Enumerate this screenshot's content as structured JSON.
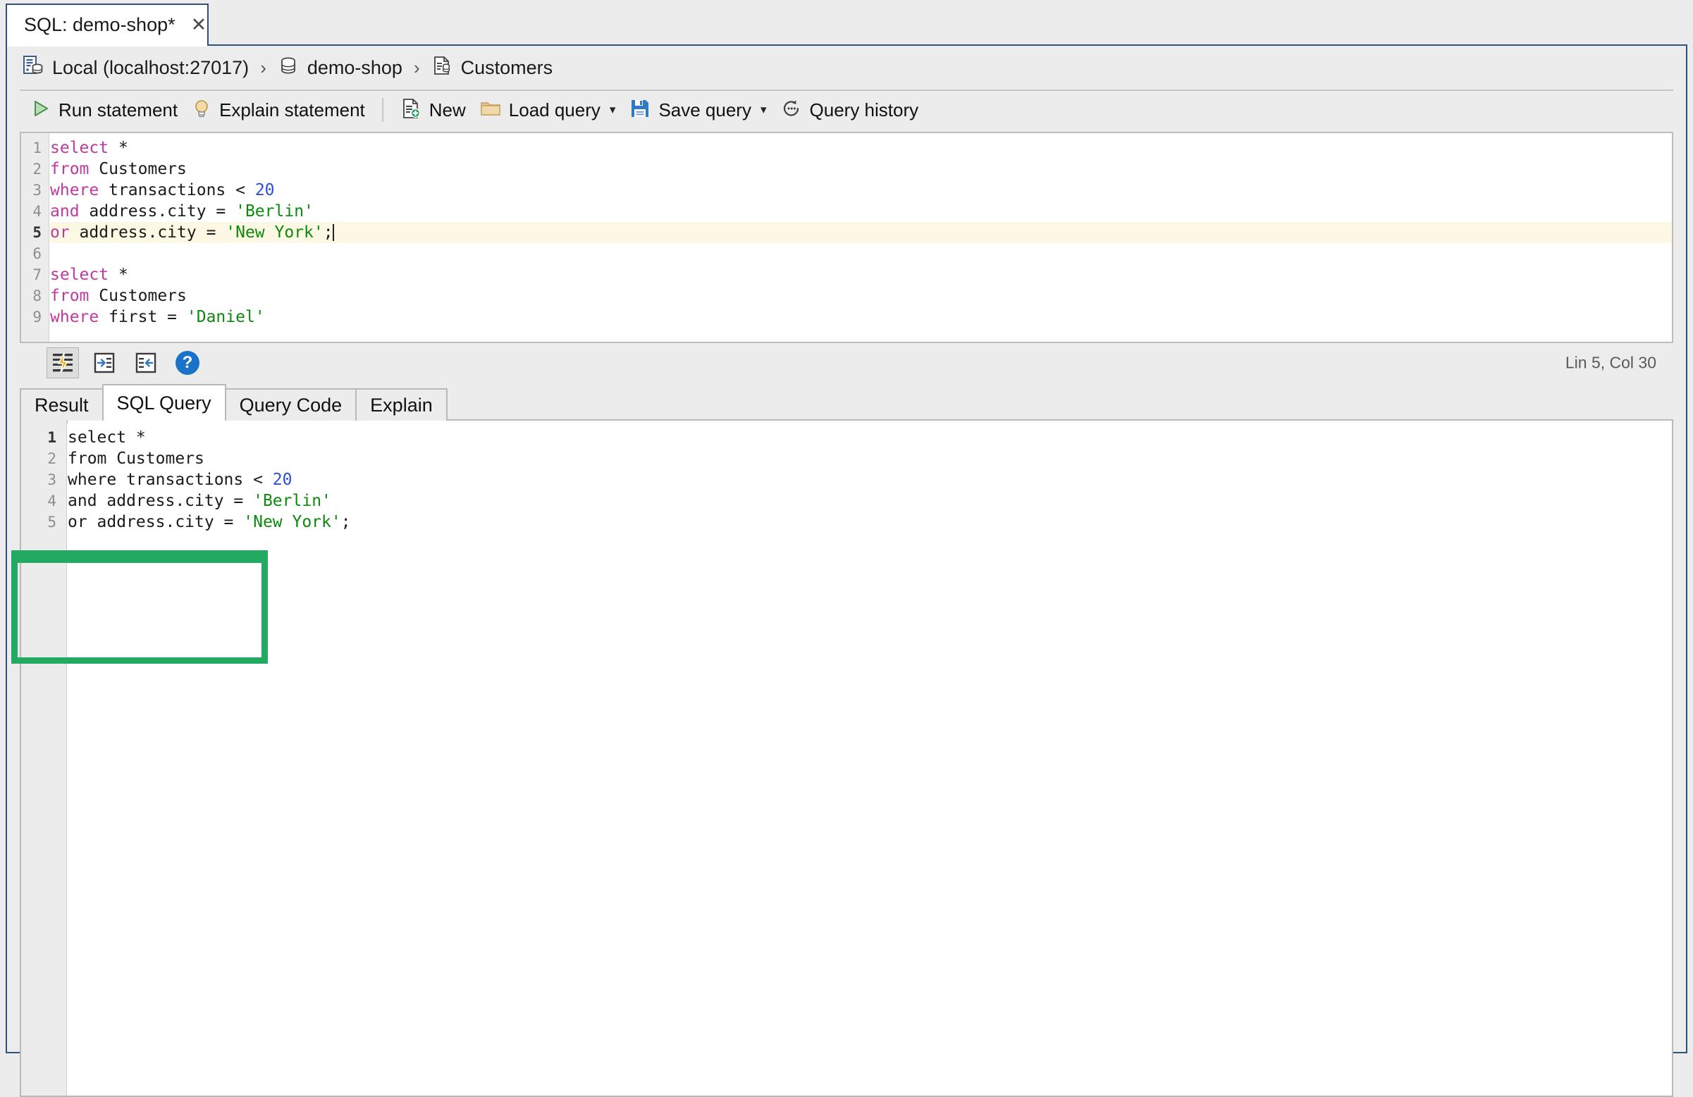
{
  "window": {
    "tab": {
      "title": "SQL: demo-shop*",
      "close_icon": "close-icon"
    }
  },
  "breadcrumb": {
    "items": [
      {
        "icon": "server-database-icon",
        "label": "Local (localhost:27017)"
      },
      {
        "icon": "database-icon",
        "label": "demo-shop"
      },
      {
        "icon": "collection-document-icon",
        "label": "Customers"
      }
    ],
    "separator": "›"
  },
  "toolbar": {
    "run_label": "Run statement",
    "explain_label": "Explain statement",
    "new_label": "New",
    "load_label": "Load query",
    "save_label": "Save query",
    "history_label": "Query history",
    "caret": "▾"
  },
  "editor": {
    "status": {
      "position": "Lin 5, Col 30"
    },
    "buttons": [
      {
        "name": "format-query-button",
        "icon": "format-lightning-icon",
        "active": true
      },
      {
        "name": "indent-right-button",
        "icon": "indent-right-icon",
        "active": false
      },
      {
        "name": "indent-left-button",
        "icon": "indent-left-icon",
        "active": false
      },
      {
        "name": "help-button",
        "icon": "help-circle-icon",
        "label": "?"
      }
    ],
    "lines": [
      {
        "n": "1",
        "tokens": [
          {
            "t": "kw",
            "v": "select"
          },
          {
            "t": "pl",
            "v": " *"
          }
        ]
      },
      {
        "n": "2",
        "tokens": [
          {
            "t": "kw",
            "v": "from"
          },
          {
            "t": "pl",
            "v": " Customers"
          }
        ]
      },
      {
        "n": "3",
        "tokens": [
          {
            "t": "kw",
            "v": "where"
          },
          {
            "t": "pl",
            "v": " transactions < "
          },
          {
            "t": "num",
            "v": "20"
          }
        ]
      },
      {
        "n": "4",
        "tokens": [
          {
            "t": "kw",
            "v": "and"
          },
          {
            "t": "pl",
            "v": " address.city = "
          },
          {
            "t": "str",
            "v": "'Berlin'"
          }
        ]
      },
      {
        "n": "5",
        "current": true,
        "tokens": [
          {
            "t": "kw",
            "v": "or"
          },
          {
            "t": "pl",
            "v": " address.city = "
          },
          {
            "t": "str",
            "v": "'New York'"
          },
          {
            "t": "pl",
            "v": ";"
          }
        ]
      },
      {
        "n": "6",
        "tokens": []
      },
      {
        "n": "7",
        "tokens": [
          {
            "t": "kw",
            "v": "select"
          },
          {
            "t": "pl",
            "v": " *"
          }
        ]
      },
      {
        "n": "8",
        "tokens": [
          {
            "t": "kw",
            "v": "from"
          },
          {
            "t": "pl",
            "v": " Customers"
          }
        ]
      },
      {
        "n": "9",
        "tokens": [
          {
            "t": "kw",
            "v": "where"
          },
          {
            "t": "pl",
            "v": " first = "
          },
          {
            "t": "str",
            "v": "'Daniel'"
          }
        ]
      }
    ]
  },
  "bottom_panel": {
    "tabs": [
      {
        "label": "Result",
        "active": false
      },
      {
        "label": "SQL Query",
        "active": true
      },
      {
        "label": "Query Code",
        "active": false
      },
      {
        "label": "Explain",
        "active": false
      }
    ],
    "lines": [
      {
        "n": "1",
        "bold": true,
        "tokens": [
          {
            "t": "pl",
            "v": "select *"
          }
        ]
      },
      {
        "n": "2",
        "bold": false,
        "tokens": [
          {
            "t": "pl",
            "v": "from Customers"
          }
        ]
      },
      {
        "n": "3",
        "bold": false,
        "tokens": [
          {
            "t": "pl",
            "v": "where transactions < "
          },
          {
            "t": "num",
            "v": "20"
          }
        ]
      },
      {
        "n": "4",
        "bold": false,
        "tokens": [
          {
            "t": "pl",
            "v": "and address.city = "
          },
          {
            "t": "str",
            "v": "'Berlin'"
          }
        ]
      },
      {
        "n": "5",
        "bold": false,
        "tokens": [
          {
            "t": "pl",
            "v": "or address.city = "
          },
          {
            "t": "str",
            "v": "'New York'"
          },
          {
            "t": "pl",
            "v": ";"
          }
        ]
      }
    ]
  },
  "annotation": {
    "type": "highlight-rectangle",
    "color": "#22aa63"
  },
  "colors": {
    "panel_border": "#31507a",
    "chrome_bg": "#ececec",
    "keyword": "#c0399f",
    "string": "#0b8a0b",
    "number": "#2a4fd8",
    "current_line": "#fdf8e3",
    "annotation_green": "#22aa63"
  }
}
